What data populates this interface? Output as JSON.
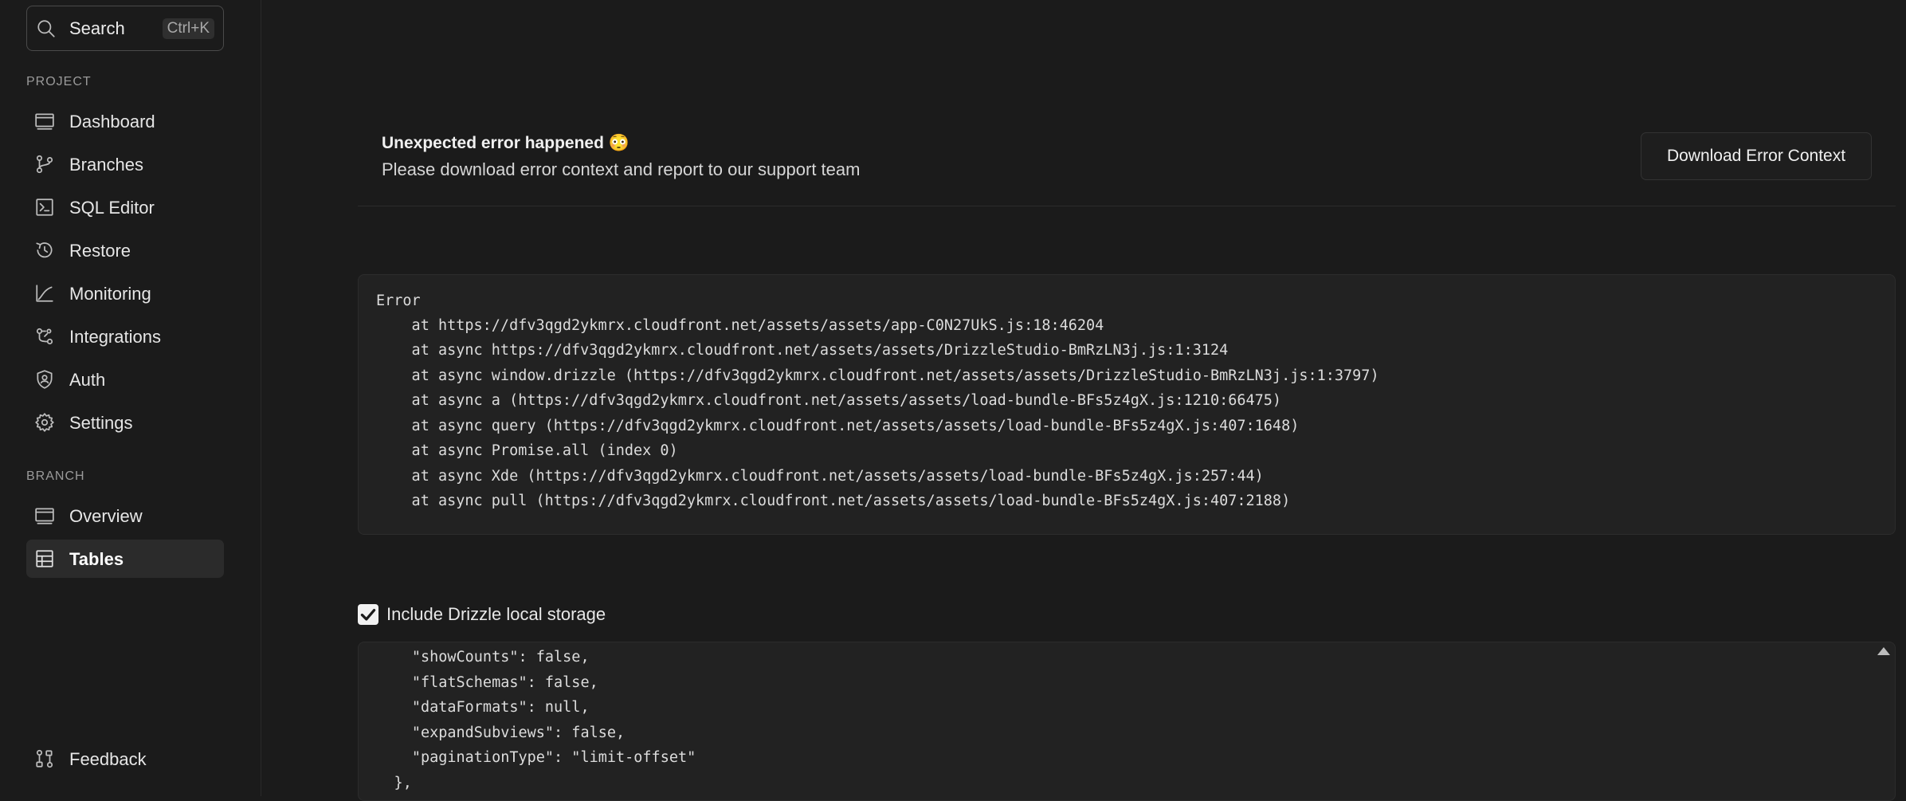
{
  "sidebar": {
    "search": {
      "label": "Search",
      "shortcut": "Ctrl+K"
    },
    "project_label": "PROJECT",
    "project_items": [
      {
        "label": "Dashboard",
        "icon": "dashboard-icon"
      },
      {
        "label": "Branches",
        "icon": "branches-icon"
      },
      {
        "label": "SQL Editor",
        "icon": "sql-editor-icon"
      },
      {
        "label": "Restore",
        "icon": "restore-icon"
      },
      {
        "label": "Monitoring",
        "icon": "monitoring-icon"
      },
      {
        "label": "Integrations",
        "icon": "integrations-icon"
      },
      {
        "label": "Auth",
        "icon": "auth-icon"
      },
      {
        "label": "Settings",
        "icon": "settings-icon"
      }
    ],
    "branch_label": "BRANCH",
    "branch_items": [
      {
        "label": "Overview",
        "icon": "overview-icon"
      },
      {
        "label": "Tables",
        "icon": "tables-icon",
        "active": true
      }
    ],
    "feedback": {
      "label": "Feedback",
      "icon": "feedback-icon"
    }
  },
  "error": {
    "title": "Unexpected error happened 😳",
    "subtitle": "Please download error context and report to our support team",
    "download_label": "Download Error Context"
  },
  "stack_trace": [
    "Error",
    "    at https://dfv3qgd2ykmrx.cloudfront.net/assets/assets/app-C0N27UkS.js:18:46204",
    "    at async https://dfv3qgd2ykmrx.cloudfront.net/assets/assets/DrizzleStudio-BmRzLN3j.js:1:3124",
    "    at async window.drizzle (https://dfv3qgd2ykmrx.cloudfront.net/assets/assets/DrizzleStudio-BmRzLN3j.js:1:3797)",
    "    at async a (https://dfv3qgd2ykmrx.cloudfront.net/assets/assets/load-bundle-BFs5z4gX.js:1210:66475)",
    "    at async query (https://dfv3qgd2ykmrx.cloudfront.net/assets/assets/load-bundle-BFs5z4gX.js:407:1648)",
    "    at async Promise.all (index 0)",
    "    at async Xde (https://dfv3qgd2ykmrx.cloudfront.net/assets/assets/load-bundle-BFs5z4gX.js:257:44)",
    "    at async pull (https://dfv3qgd2ykmrx.cloudfront.net/assets/assets/load-bundle-BFs5z4gX.js:407:2188)"
  ],
  "local_storage": {
    "checkbox_label": "Include Drizzle local storage",
    "checked": true,
    "lines": [
      "      \"showCounts\": false,",
      "      \"flatSchemas\": false,",
      "      \"dataFormats\": null,",
      "      \"expandSubviews\": false,",
      "      \"paginationType\": \"limit-offset\"",
      "    },"
    ]
  }
}
